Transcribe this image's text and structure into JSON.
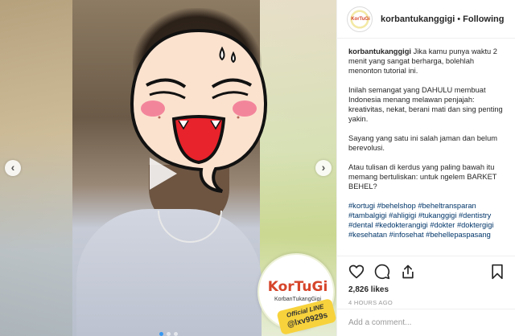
{
  "post": {
    "username": "korbantukanggigi",
    "separator": "•",
    "follow_status": "Following",
    "caption": {
      "username": "korbantukanggigi",
      "paragraphs": [
        "Jika kamu punya waktu 2 menit yang sangat berharga, bolehlah menonton tutorial ini.",
        "Inilah semangat yang DAHULU membuat Indonesia menang melawan penjajah: kreativitas, nekat, berani mati dan sing penting yakin.",
        "Sayang yang satu ini salah jaman dan belum berevolusi.",
        "Atau tulisan di kerdus yang paling bawah itu memang bertuliskan: untuk ngelem BARKET BEHEL?"
      ],
      "hashtags": [
        "#kortugi",
        "#behelshop",
        "#beheltransparan",
        "#tambalgigi",
        "#ahligigi",
        "#tukanggigi",
        "#dentistry",
        "#dental",
        "#kedokterangigi",
        "#dokter",
        "#doktergigi",
        "#kesehatan",
        "#infosehat",
        "#behellepaspasang"
      ]
    },
    "likes": "2,826 likes",
    "timestamp": "4 HOURS AGO",
    "comment_placeholder": "Add a comment..."
  },
  "media": {
    "sticker_brand": "KorTuGi",
    "sticker_subtitle": "KorbanTukangGigi",
    "sticker_line_label": "Official LINE",
    "sticker_line_id": "@lxv9929s",
    "avatar_text": "KorTuGi",
    "carousel_active_index": 0,
    "carousel_count": 3
  },
  "icons": {
    "like": "heart-icon",
    "comment": "comment-icon",
    "share": "share-icon",
    "save": "bookmark-icon",
    "prev": "chevron-left-icon",
    "next": "chevron-right-icon",
    "play": "play-icon"
  },
  "colors": {
    "link": "#003569",
    "brand_red": "#d6452a",
    "carousel_active": "#3897f0"
  }
}
